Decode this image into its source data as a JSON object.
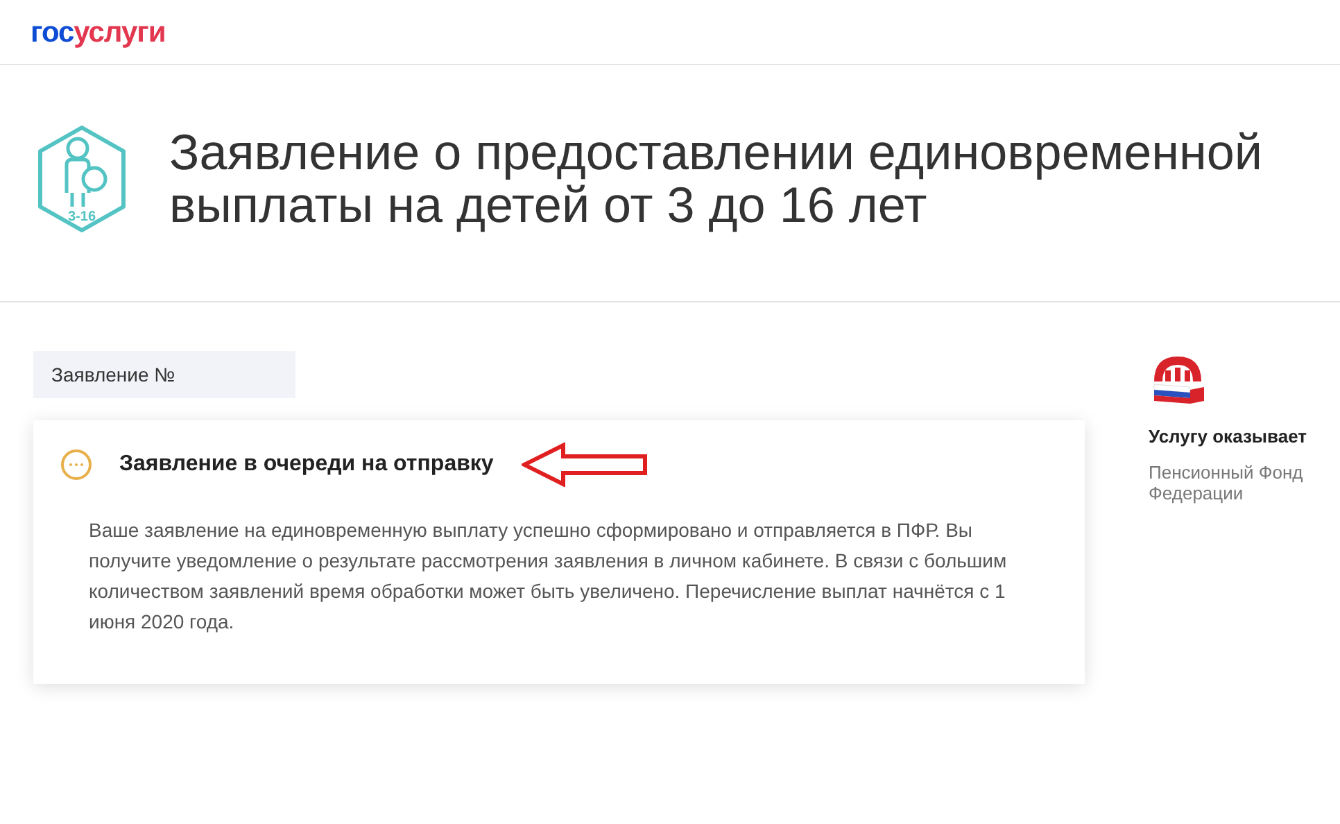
{
  "header": {
    "logo": {
      "part_1": "гос",
      "part_2": "услуги"
    }
  },
  "page": {
    "icon_label": "3-16",
    "title": "Заявление о предоставлении единовременной выплаты на детей от 3 до 16 лет"
  },
  "application_number": {
    "label": "Заявление №"
  },
  "status_card": {
    "pending": true,
    "title": "Заявление в очереди на отправку",
    "arrow": true,
    "text": "Ваше заявление на единовременную выплату успешно сформировано и отправляется в ПФР. Вы получите уведомление о результате рассмотрения заявления в личном кабинете. В связи с большим количеством заявлений время обработки может быть увеличено. Перечисление выплат начнётся с 1 июня 2020 года."
  },
  "provider": {
    "heading": "Услугу оказывает",
    "name_lines": [
      "Пенсионный Фонд",
      "Федерации"
    ]
  }
}
